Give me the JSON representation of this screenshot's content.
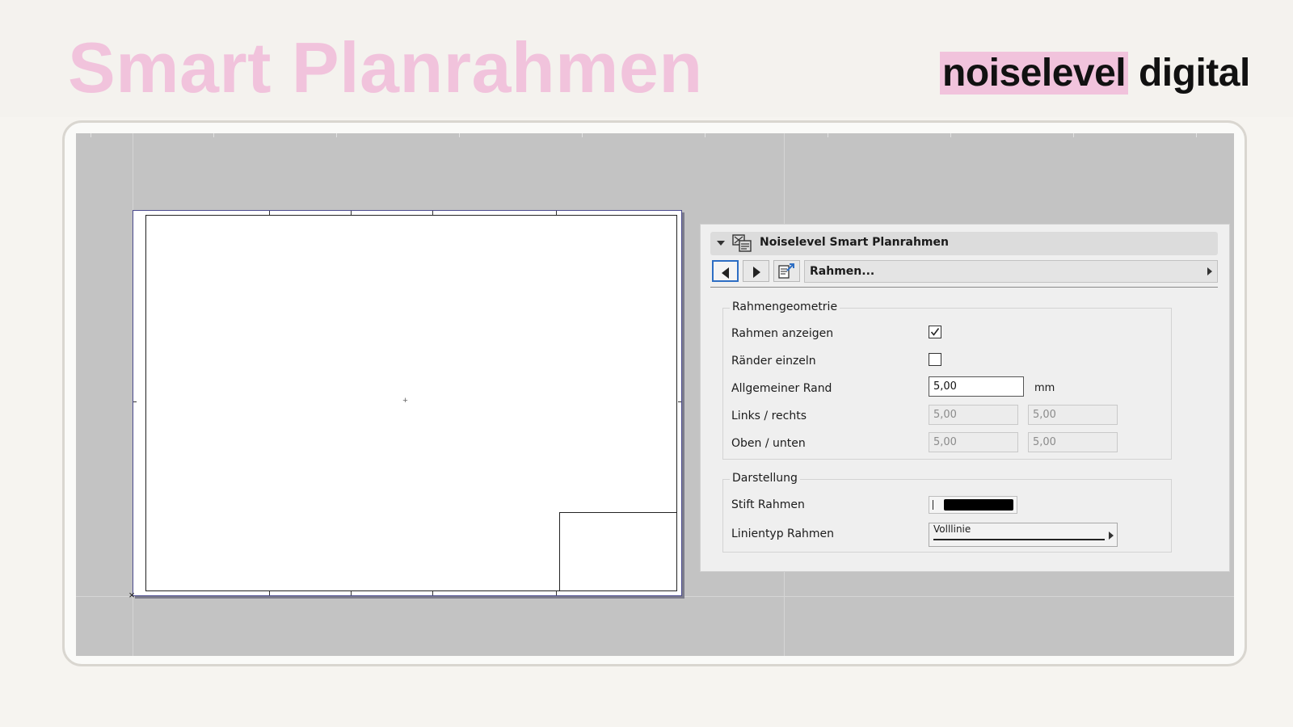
{
  "slide": {
    "title": "Smart Planrahmen",
    "brand": {
      "highlight": "noiselevel",
      "rest": " digital",
      "highlight_color": "#f1c3dc"
    }
  },
  "panel": {
    "title": "Noiselevel Smart Planrahmen",
    "page_select": "Rahmen...",
    "groups": {
      "geometry": {
        "title": "Rahmengeometrie",
        "show_frame": {
          "label": "Rahmen anzeigen",
          "checked": true
        },
        "single_margins": {
          "label": "Ränder einzeln",
          "checked": false
        },
        "general_margin": {
          "label": "Allgemeiner Rand",
          "value": "5,00",
          "unit": "mm"
        },
        "left_right": {
          "label": "Links / rechts",
          "left": "5,00",
          "right": "5,00"
        },
        "top_bottom": {
          "label": "Oben / unten",
          "top": "5,00",
          "bottom": "5,00"
        }
      },
      "display": {
        "title": "Darstellung",
        "frame_pen": {
          "label": "Stift Rahmen",
          "color": "#000000"
        },
        "line_type": {
          "label": "Linientyp Rahmen",
          "value": "Volllinie"
        }
      }
    }
  },
  "icons": [
    "caret-down-icon",
    "object-icon",
    "arrow-left-icon",
    "arrow-right-icon",
    "settings-page-icon",
    "chevron-right-icon",
    "checkmark-icon"
  ],
  "colors": {
    "canvas": "#c3c3c3",
    "accent_focus": "#2d6ec4",
    "sheet_border": "#4b4b8e"
  }
}
